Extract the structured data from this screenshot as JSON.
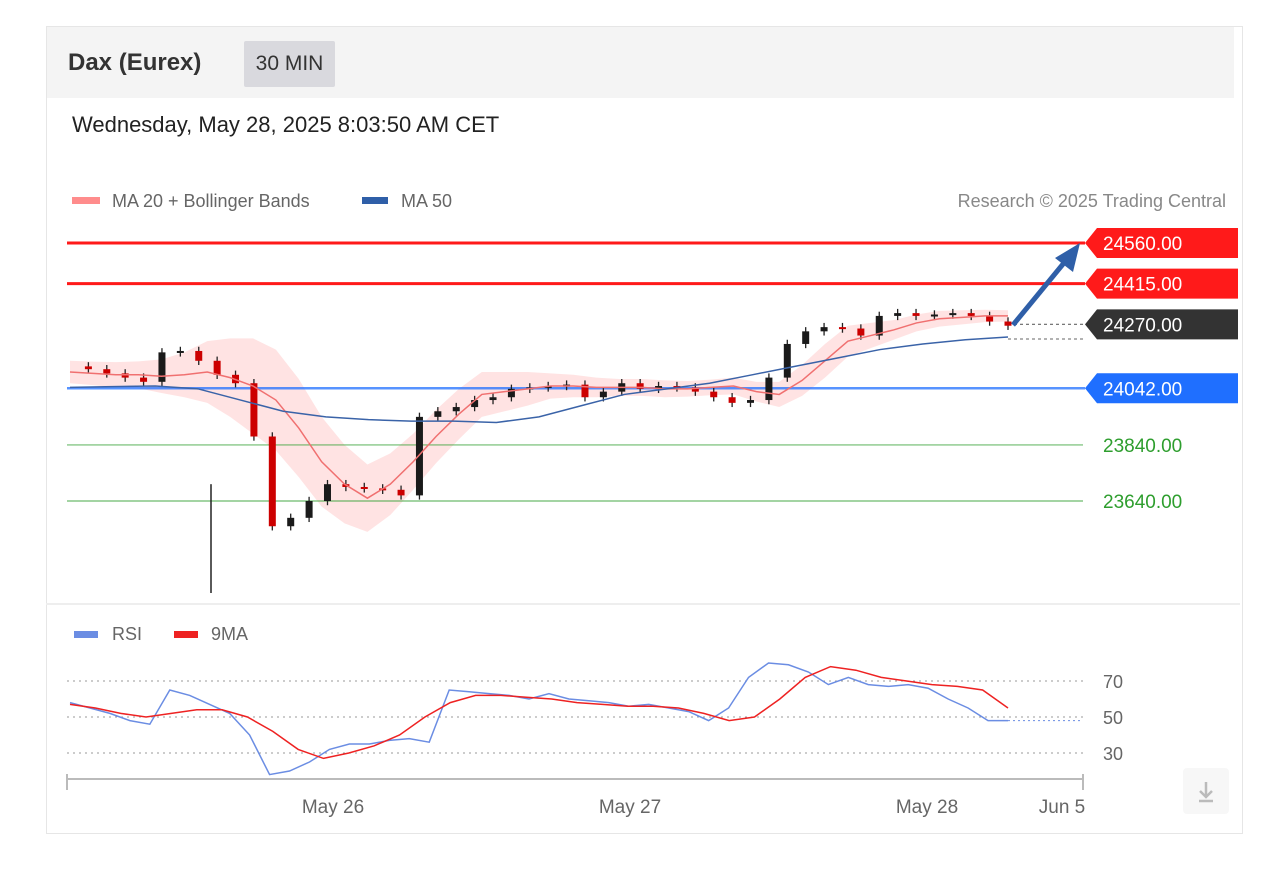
{
  "header": {
    "title": "Dax (Eurex)",
    "timeframe": "30 MIN",
    "datetime": "Wednesday, May 28, 2025 8:03:50 AM CET"
  },
  "legend": {
    "ma20": "MA 20 + Bollinger Bands",
    "ma50": "MA 50",
    "copyright": "Research © 2025 Trading Central",
    "rsi": "RSI",
    "rsi_ma": "9MA"
  },
  "colors": {
    "resistance": "#ff1a1a",
    "pivot": "#1f6fff",
    "support": "#2e9e2e",
    "current": "#333333",
    "candle_up": "#1a1a1a",
    "candle_down": "#cc0000",
    "bollinger_fill": "#ffd9d9",
    "ma20": "#f07070",
    "ma50": "#3a63a8",
    "rsi": "#6b8de3",
    "rsi_ma": "#ee2222",
    "arrow": "#2f5fa8"
  },
  "chart_data": [
    {
      "type": "candlestick",
      "instrument": "Dax (Eurex)",
      "interval": "30 MIN",
      "x_ticks": [
        "May 26",
        "May 27",
        "May 28",
        "Jun 5"
      ],
      "ylim": [
        23450,
        24650
      ],
      "levels": [
        {
          "value": 24560.0,
          "label": "24560.00",
          "kind": "resistance"
        },
        {
          "value": 24415.0,
          "label": "24415.00",
          "kind": "resistance"
        },
        {
          "value": 24270.0,
          "label": "24270.00",
          "kind": "current"
        },
        {
          "value": 24042.0,
          "label": "24042.00",
          "kind": "pivot"
        },
        {
          "value": 23840.0,
          "label": "23840.00",
          "kind": "support"
        },
        {
          "value": 23640.0,
          "label": "23640.00",
          "kind": "support"
        }
      ],
      "price": [
        24120,
        24110,
        24095,
        24080,
        24065,
        24170,
        24175,
        24140,
        24090,
        24060,
        23870,
        23550,
        23580,
        23640,
        23700,
        23690,
        23685,
        23680,
        23660,
        23940,
        23960,
        23975,
        24000,
        24010,
        24040,
        24045,
        24050,
        24055,
        24010,
        24030,
        24060,
        24040,
        24050,
        24045,
        24030,
        24010,
        23990,
        24000,
        24080,
        24200,
        24245,
        24260,
        24255,
        24230,
        24300,
        24310,
        24300,
        24305,
        24310,
        24300,
        24280,
        24265
      ],
      "ma20": [
        24100,
        24095,
        24090,
        24090,
        24085,
        24090,
        24100,
        24080,
        24050,
        24000,
        23900,
        23780,
        23700,
        23650,
        23700,
        23780,
        23870,
        23950,
        24020,
        24030,
        24040,
        24050,
        24050,
        24045,
        24045,
        24045,
        24040,
        24040,
        24045,
        24050,
        24030,
        24020,
        24070,
        24140,
        24210,
        24230,
        24250,
        24275,
        24290,
        24295,
        24300,
        24300
      ],
      "ma50": [
        24045,
        24048,
        24050,
        24040,
        24000,
        23960,
        23940,
        23930,
        23925,
        23925,
        23920,
        23940,
        23980,
        24020,
        24040,
        24060,
        24090,
        24120,
        24150,
        24180,
        24200,
        24215,
        24225
      ]
    },
    {
      "type": "line",
      "name": "RSI",
      "ylim": [
        15,
        85
      ],
      "ticks": [
        70,
        50,
        30
      ],
      "series": [
        {
          "name": "RSI",
          "values": [
            58,
            55,
            52,
            48,
            46,
            65,
            62,
            57,
            52,
            40,
            18,
            20,
            25,
            32,
            35,
            35,
            37,
            38,
            36,
            65,
            64,
            63,
            62,
            60,
            63,
            60,
            59,
            58,
            56,
            57,
            55,
            53,
            48,
            55,
            72,
            80,
            79,
            75,
            68,
            72,
            68,
            67,
            68,
            66,
            60,
            55,
            48,
            48
          ]
        },
        {
          "name": "9MA",
          "values": [
            57,
            55,
            52,
            50,
            52,
            54,
            54,
            50,
            42,
            32,
            27,
            30,
            34,
            40,
            50,
            58,
            62,
            62,
            61,
            60,
            58,
            57,
            56,
            56,
            55,
            52,
            48,
            50,
            60,
            72,
            78,
            76,
            72,
            70,
            68,
            67,
            65,
            55
          ]
        }
      ]
    }
  ]
}
